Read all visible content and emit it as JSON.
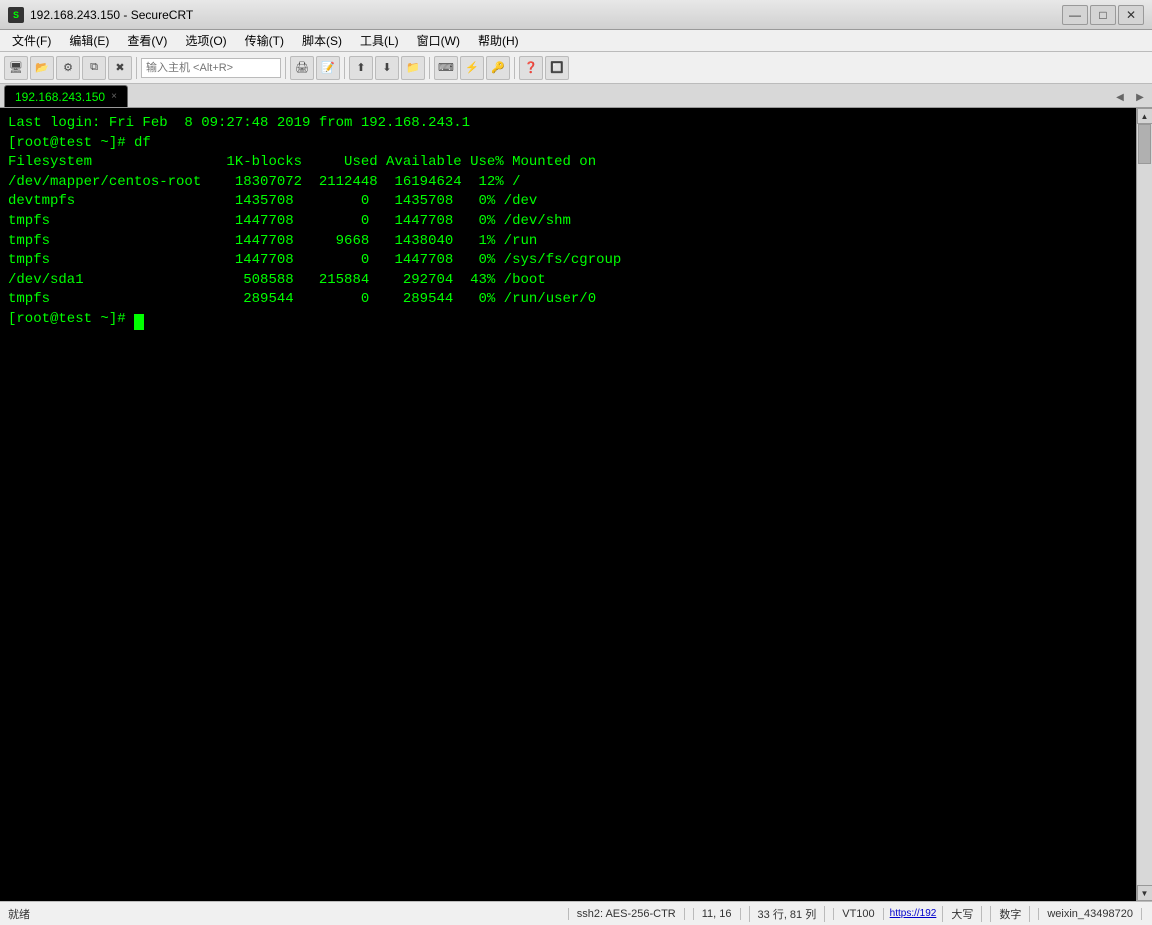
{
  "window": {
    "title": "192.168.243.150 - SecureCRT",
    "icon": "S"
  },
  "titlebar": {
    "minimize": "—",
    "maximize": "□",
    "close": "✕"
  },
  "menubar": {
    "items": [
      "文件(F)",
      "编辑(E)",
      "查看(V)",
      "选项(O)",
      "传输(T)",
      "脚本(S)",
      "工具(L)",
      "窗口(W)",
      "帮助(H)"
    ]
  },
  "toolbar": {
    "input_placeholder": "输入主机 <Alt+R>"
  },
  "tab": {
    "label": "192.168.243.150",
    "close": "×"
  },
  "terminal": {
    "lines": [
      "Last login: Fri Feb  8 09:27:48 2019 from 192.168.243.1",
      "[root@test ~]# df",
      "Filesystem                1K-blocks     Used Available Use% Mounted on",
      "/dev/mapper/centos-root    18307072  2112448  16194624  12% /",
      "devtmpfs                   1435708        0   1435708   0% /dev",
      "tmpfs                      1447708        0   1447708   0% /dev/shm",
      "tmpfs                      1447708     9668   1438040   1% /run",
      "tmpfs                      1447708        0   1447708   0% /sys/fs/cgroup",
      "/dev/sda1                   508588   215884    292704  43% /boot",
      "tmpfs                       289544        0    289544   0% /run/user/0",
      "[root@test ~]# "
    ]
  },
  "statusbar": {
    "left": "就绪",
    "session": "ssh2: AES-256-CTR",
    "position": "11, 16",
    "size": "33 行, 81 列",
    "terminal": "VT100",
    "url": "https://192",
    "caps": "大写",
    "num": "数字",
    "user": "weixin_43498720"
  }
}
